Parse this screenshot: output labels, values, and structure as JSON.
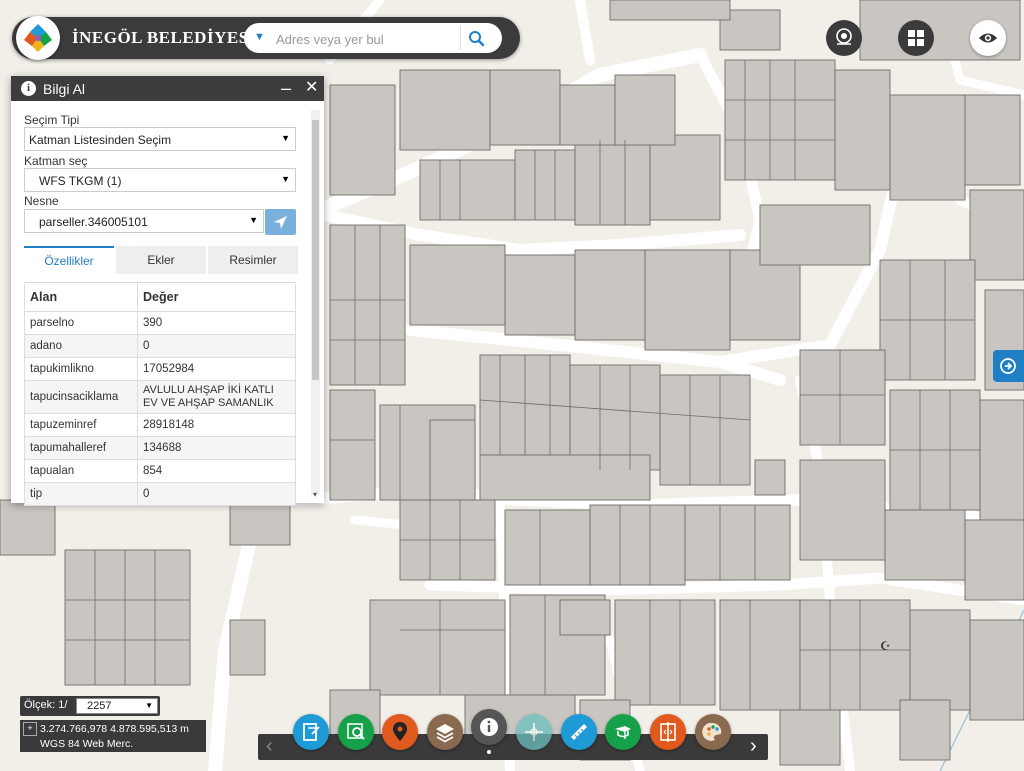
{
  "header": {
    "title": "İNEGÖL BELEDİYESİ",
    "search_placeholder": "Adres veya yer bul"
  },
  "top_buttons": [
    {
      "icon": "map-pin-group-icon"
    },
    {
      "icon": "grid-icon"
    },
    {
      "icon": "eye-icon"
    }
  ],
  "panel": {
    "title": "Bilgi Al",
    "minimize": "–",
    "close": "✕",
    "selection_type_label": "Seçim Tipi",
    "selection_type_value": "Katman Listesinden Seçim",
    "layer_label": "Katman seç",
    "layer_value": "WFS TKGM (1)",
    "object_label": "Nesne",
    "object_value": "parseller.346005101",
    "tabs": [
      "Özellikler",
      "Ekler",
      "Resimler"
    ],
    "table_headers": [
      "Alan",
      "Değer"
    ],
    "rows": [
      [
        "parselno",
        "390"
      ],
      [
        "adano",
        "0"
      ],
      [
        "tapukimlikno",
        "17052984"
      ],
      [
        "tapucinsaciklama",
        "AVLULU AHŞAP İKİ KATLI EV VE AHŞAP SAMANLIK"
      ],
      [
        "tapuzeminref",
        "28918148"
      ],
      [
        "tapumahalleref",
        "134688"
      ],
      [
        "tapualan",
        "854"
      ],
      [
        "tip",
        "0"
      ]
    ]
  },
  "scale": {
    "label": "Ölçek: 1/",
    "value": "2257"
  },
  "coords": {
    "value": "3.274.766,978 4.878.595,513 m",
    "crs": "WGS 84 Web Merc."
  },
  "toolbar": {
    "prev": "‹",
    "next": "›",
    "tools": [
      {
        "name": "layers-panel-icon",
        "color": "#1e9ad6"
      },
      {
        "name": "search-location-icon",
        "color": "#16a04a"
      },
      {
        "name": "location-pin-icon",
        "color": "#e05a1e"
      },
      {
        "name": "layers-icon",
        "color": "#8a6a4f"
      },
      {
        "name": "info-icon",
        "color": "#555555"
      },
      {
        "name": "coordinate-icon",
        "color": "#6cc0bf"
      },
      {
        "name": "measure-icon",
        "color": "#1e9ad6"
      },
      {
        "name": "print-icon",
        "color": "#16a04a"
      },
      {
        "name": "compare-icon",
        "color": "#e05a1e"
      },
      {
        "name": "palette-icon",
        "color": "#8a6a4f"
      }
    ]
  }
}
